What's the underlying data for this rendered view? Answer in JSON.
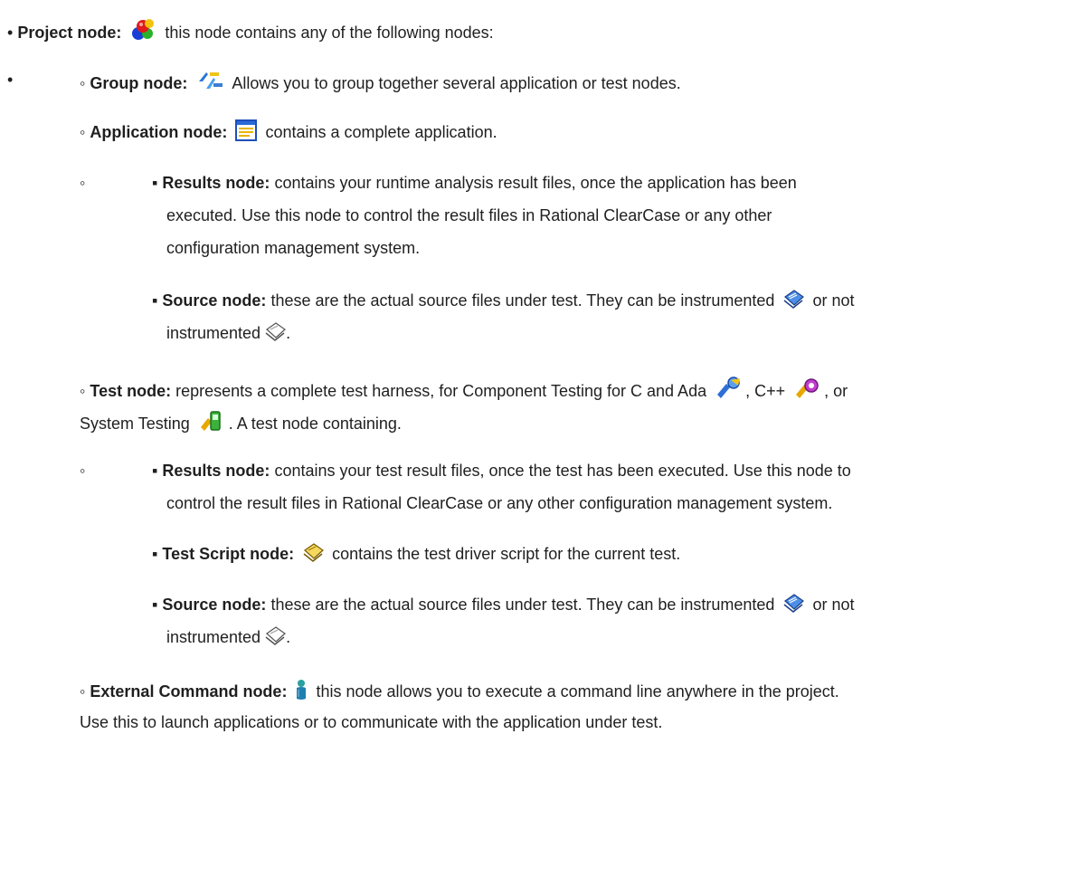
{
  "project": {
    "label": "Project node:",
    "text": "this node contains any of the following nodes:",
    "icon": "project-icon"
  },
  "group": {
    "label": "Group node:",
    "text": "Allows you to group together several application or test nodes.",
    "icon": "group-icon"
  },
  "application": {
    "label": "Application node:",
    "text": "contains a complete application.",
    "icon": "application-icon"
  },
  "app_results": {
    "label": "Results node:",
    "line1": "contains your runtime analysis result files, once the application has been",
    "line2": "executed. Use this node to control the result files in Rational ClearCase or any other",
    "line3": "configuration management system."
  },
  "app_source": {
    "label": "Source node:",
    "line1": "these are the actual source files under test. They can be instrumented",
    "or_not": "or not",
    "line2": "instrumented",
    "period": "."
  },
  "test": {
    "label": "Test node:",
    "line1a": "represents a complete test harness, for Component Testing for C and Ada",
    "line1b": ", C++",
    "line1c": ", or",
    "line2a": "System Testing",
    "line2b": ". A test node containing."
  },
  "test_results": {
    "label": "Results node:",
    "line1": "contains your test result files, once the test has been executed. Use this node to",
    "line2": "control the result files in Rational ClearCase or any other configuration management system."
  },
  "test_script": {
    "label": "Test Script node:",
    "text": "contains the test driver script for the current test."
  },
  "test_source": {
    "label": "Source node:",
    "line1": "these are the actual source files under test. They can be instrumented",
    "or_not": "or not",
    "line2": "instrumented",
    "period": "."
  },
  "external": {
    "label": "External Command node:",
    "line1": "this node allows you to execute a command line anywhere in the project.",
    "line2": "Use this to launch applications or to communicate with the application under test."
  },
  "bullets": {
    "disc": "•",
    "circle": "◦",
    "square": "▪"
  }
}
